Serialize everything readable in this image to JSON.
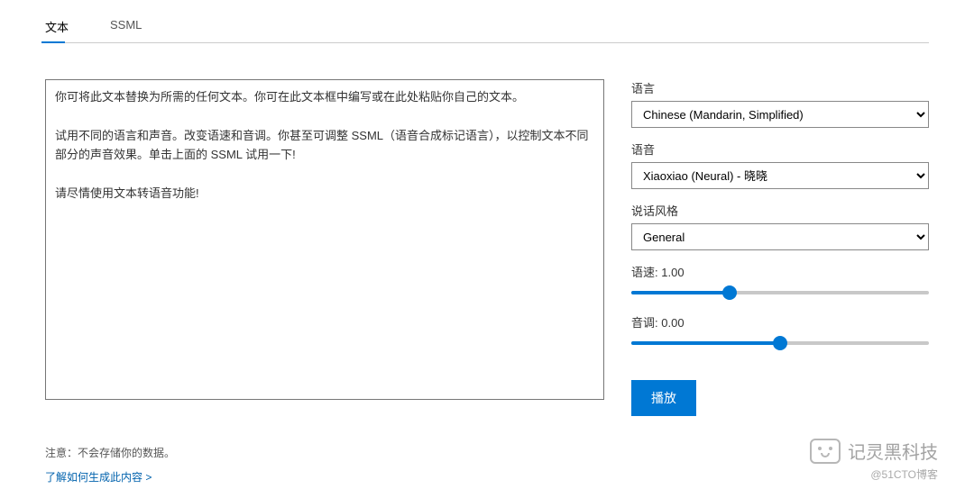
{
  "tabs": {
    "text": "文本",
    "ssml": "SSML"
  },
  "textarea_content": "你可将此文本替换为所需的任何文本。你可在此文本框中编写或在此处粘贴你自己的文本。\n\n试用不同的语言和声音。改变语速和音调。你甚至可调整 SSML（语音合成标记语言），以控制文本不同部分的声音效果。单击上面的 SSML 试用一下!\n\n请尽情使用文本转语音功能!",
  "controls": {
    "language": {
      "label": "语言",
      "value": "Chinese (Mandarin, Simplified)"
    },
    "voice": {
      "label": "语音",
      "value": "Xiaoxiao (Neural) - 晓晓"
    },
    "style": {
      "label": "说话风格",
      "value": "General"
    },
    "speed": {
      "label": "语速:",
      "value": "1.00",
      "percent": 33
    },
    "pitch": {
      "label": "音调:",
      "value": "0.00",
      "percent": 50
    },
    "play": "播放"
  },
  "footer": {
    "notice": "注意：不会存储你的数据。",
    "learn_more": "了解如何生成此内容 >"
  },
  "watermark": {
    "text": "记灵黑科技",
    "sub": "@51CTO博客"
  }
}
